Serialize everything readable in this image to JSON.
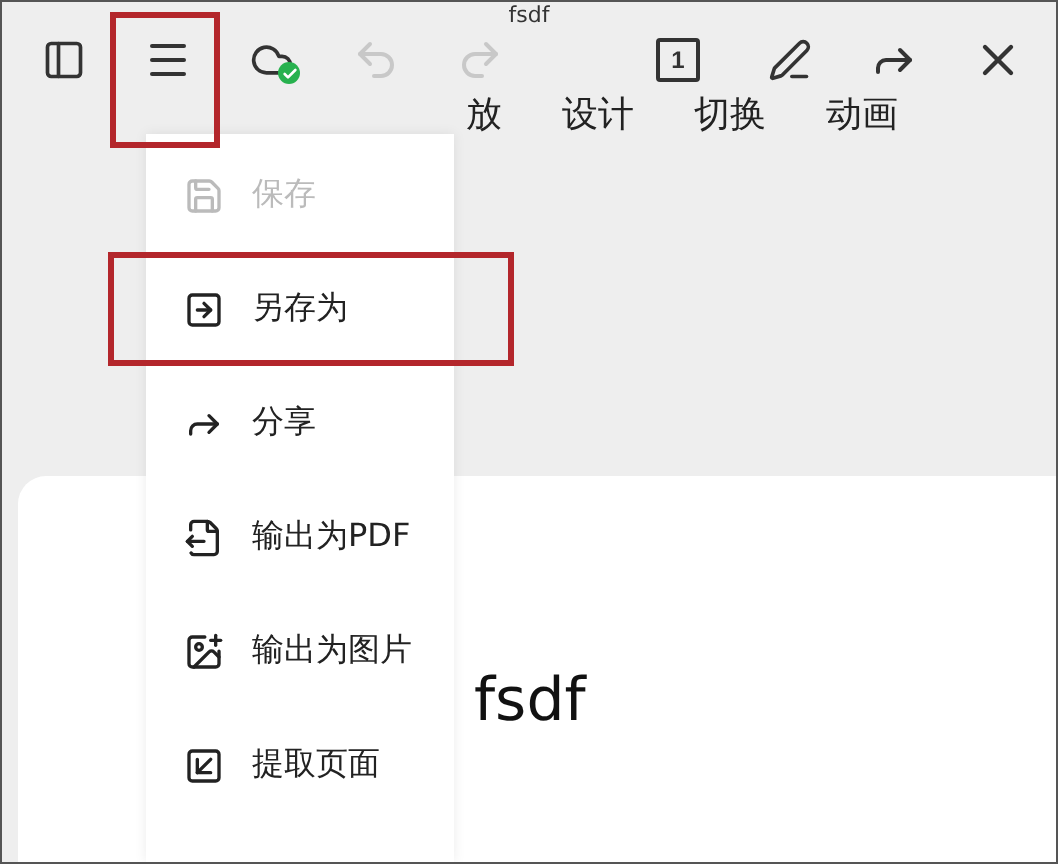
{
  "window": {
    "title": "fsdf"
  },
  "toolbar": {
    "menu_button_highlighted": true,
    "cloud_synced": true,
    "undo_disabled": true,
    "redo_disabled": true,
    "page_count": "1"
  },
  "ribbon_tabs": [
    {
      "label": "放",
      "selected": false
    },
    {
      "label": "设计",
      "selected": false
    },
    {
      "label": "切换",
      "selected": false
    },
    {
      "label": "动画",
      "selected": false
    }
  ],
  "menu": {
    "items": [
      {
        "kind": "save",
        "label": "保存",
        "disabled": true,
        "highlighted": false
      },
      {
        "kind": "save-as",
        "label": "另存为",
        "disabled": false,
        "highlighted": true
      },
      {
        "kind": "share",
        "label": "分享",
        "disabled": false,
        "highlighted": false
      },
      {
        "kind": "pdf",
        "label": "输出为PDF",
        "disabled": false,
        "highlighted": false
      },
      {
        "kind": "image",
        "label": "输出为图片",
        "disabled": false,
        "highlighted": false
      },
      {
        "kind": "extract",
        "label": "提取页面",
        "disabled": false,
        "highlighted": false
      }
    ]
  },
  "slide": {
    "text": "fsdf"
  }
}
